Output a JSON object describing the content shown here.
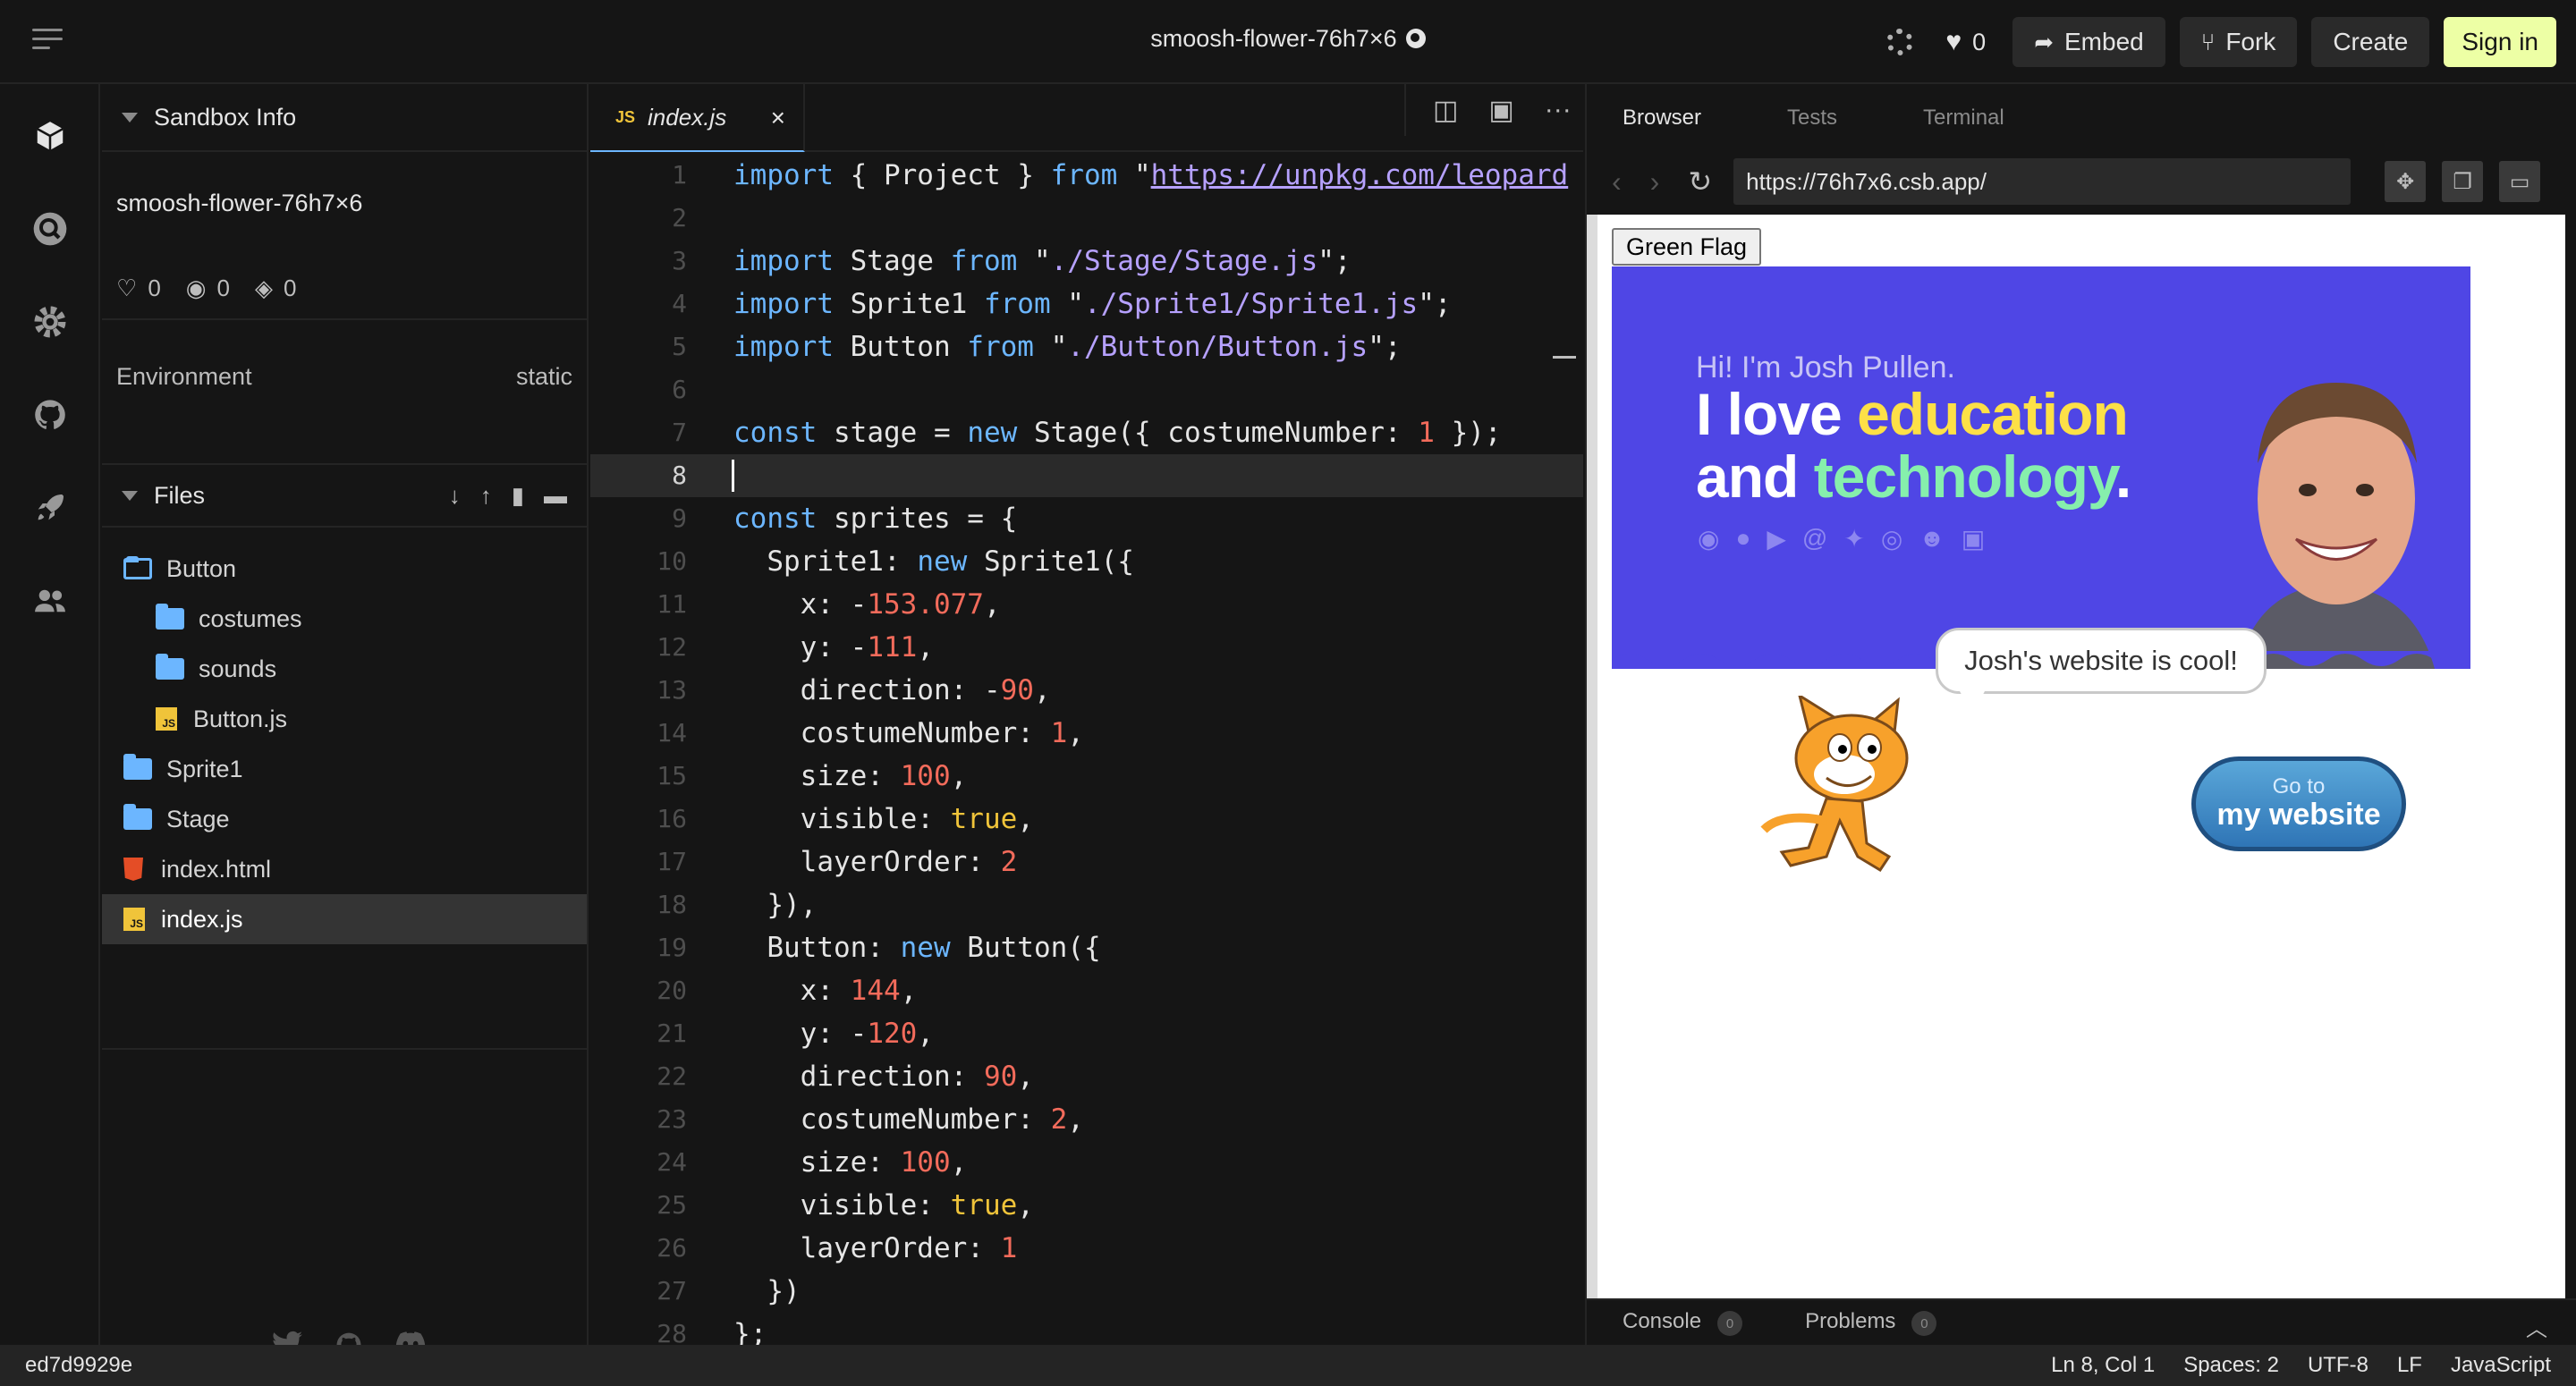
{
  "header": {
    "title": "smoosh-flower-76h7×6",
    "likes": "0",
    "embed_label": "Embed",
    "fork_label": "Fork",
    "create_label": "Create",
    "signin_label": "Sign in"
  },
  "activity_bar": {
    "icons": [
      "cube-icon",
      "search-icon",
      "gear-icon",
      "github-icon",
      "rocket-icon",
      "users-icon"
    ]
  },
  "sidebar": {
    "sandbox_info_title": "Sandbox Info",
    "sandbox_name": "smoosh-flower-76h7×6",
    "likes": "0",
    "views": "0",
    "forks": "0",
    "environment_label": "Environment",
    "environment_value": "static",
    "files_title": "Files",
    "tree": [
      {
        "name": "Button",
        "type": "folder-open"
      },
      {
        "name": "costumes",
        "type": "folder"
      },
      {
        "name": "sounds",
        "type": "folder"
      },
      {
        "name": "Button.js",
        "type": "js"
      },
      {
        "name": "Sprite1",
        "type": "folder"
      },
      {
        "name": "Stage",
        "type": "folder"
      },
      {
        "name": "index.html",
        "type": "html"
      },
      {
        "name": "index.js",
        "type": "js"
      }
    ]
  },
  "editor": {
    "tab_label": "index.js",
    "tab_type": "JS",
    "cursor_line": 8,
    "lines": [
      [
        [
          "k",
          "import"
        ],
        [
          "p",
          " { Project } "
        ],
        [
          "k",
          "from"
        ],
        [
          "p",
          " \""
        ],
        [
          "u",
          "https://unpkg.com/leopard"
        ]
      ],
      [],
      [
        [
          "k",
          "import"
        ],
        [
          "p",
          " Stage "
        ],
        [
          "k",
          "from"
        ],
        [
          "p",
          " \""
        ],
        [
          "s",
          "./Stage/Stage.js"
        ],
        [
          "p",
          "\";"
        ]
      ],
      [
        [
          "k",
          "import"
        ],
        [
          "p",
          " Sprite1 "
        ],
        [
          "k",
          "from"
        ],
        [
          "p",
          " \""
        ],
        [
          "s",
          "./Sprite1/Sprite1.js"
        ],
        [
          "p",
          "\";"
        ]
      ],
      [
        [
          "k",
          "import"
        ],
        [
          "p",
          " Button "
        ],
        [
          "k",
          "from"
        ],
        [
          "p",
          " \""
        ],
        [
          "s",
          "./Button/Button.js"
        ],
        [
          "p",
          "\";"
        ]
      ],
      [],
      [
        [
          "k",
          "const"
        ],
        [
          "p",
          " stage = "
        ],
        [
          "k",
          "new"
        ],
        [
          "p",
          " Stage({ costumeNumber: "
        ],
        [
          "n",
          "1"
        ],
        [
          "p",
          " });"
        ]
      ],
      [],
      [
        [
          "k",
          "const"
        ],
        [
          "p",
          " sprites = {"
        ]
      ],
      [
        [
          "p",
          "  Sprite1: "
        ],
        [
          "k",
          "new"
        ],
        [
          "p",
          " Sprite1({"
        ]
      ],
      [
        [
          "p",
          "    x: -"
        ],
        [
          "n",
          "153.077"
        ],
        [
          "p",
          ","
        ]
      ],
      [
        [
          "p",
          "    y: -"
        ],
        [
          "n",
          "111"
        ],
        [
          "p",
          ","
        ]
      ],
      [
        [
          "p",
          "    direction: -"
        ],
        [
          "n",
          "90"
        ],
        [
          "p",
          ","
        ]
      ],
      [
        [
          "p",
          "    costumeNumber: "
        ],
        [
          "n",
          "1"
        ],
        [
          "p",
          ","
        ]
      ],
      [
        [
          "p",
          "    size: "
        ],
        [
          "n",
          "100"
        ],
        [
          "p",
          ","
        ]
      ],
      [
        [
          "p",
          "    visible: "
        ],
        [
          "b",
          "true"
        ],
        [
          "p",
          ","
        ]
      ],
      [
        [
          "p",
          "    layerOrder: "
        ],
        [
          "n",
          "2"
        ]
      ],
      [
        [
          "p",
          "  }),"
        ]
      ],
      [
        [
          "p",
          "  Button: "
        ],
        [
          "k",
          "new"
        ],
        [
          "p",
          " Button({"
        ]
      ],
      [
        [
          "p",
          "    x: "
        ],
        [
          "n",
          "144"
        ],
        [
          "p",
          ","
        ]
      ],
      [
        [
          "p",
          "    y: -"
        ],
        [
          "n",
          "120"
        ],
        [
          "p",
          ","
        ]
      ],
      [
        [
          "p",
          "    direction: "
        ],
        [
          "n",
          "90"
        ],
        [
          "p",
          ","
        ]
      ],
      [
        [
          "p",
          "    costumeNumber: "
        ],
        [
          "n",
          "2"
        ],
        [
          "p",
          ","
        ]
      ],
      [
        [
          "p",
          "    size: "
        ],
        [
          "n",
          "100"
        ],
        [
          "p",
          ","
        ]
      ],
      [
        [
          "p",
          "    visible: "
        ],
        [
          "b",
          "true"
        ],
        [
          "p",
          ","
        ]
      ],
      [
        [
          "p",
          "    layerOrder: "
        ],
        [
          "n",
          "1"
        ]
      ],
      [
        [
          "p",
          "  })"
        ]
      ],
      [
        [
          "p",
          "};"
        ]
      ]
    ]
  },
  "preview": {
    "tabs": [
      "Browser",
      "Tests",
      "Terminal"
    ],
    "url": "https://76h7x6.csb.app/",
    "green_flag_label": "Green Flag",
    "banner_hi": "Hi! I'm Josh Pullen.",
    "banner_line1_a": "I love ",
    "banner_line1_b": "education",
    "banner_line2_a": "and ",
    "banner_line2_b": "technology",
    "banner_line2_c": ".",
    "speech": "Josh's website is cool!",
    "go_to_a": "Go to",
    "go_to_b": "my website",
    "console_label": "Console",
    "console_count": "0",
    "problems_label": "Problems",
    "problems_count": "0"
  },
  "status_bar": {
    "commit": "ed7d9929e",
    "position": "Ln 8, Col 1",
    "spaces": "Spaces: 2",
    "encoding": "UTF-8",
    "eol": "LF",
    "language": "JavaScript"
  }
}
